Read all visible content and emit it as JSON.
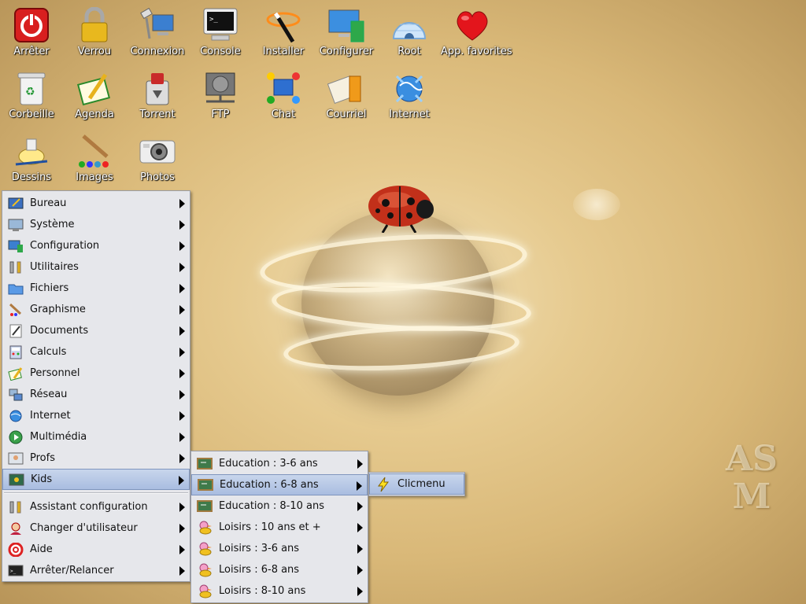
{
  "desktop_icons": [
    {
      "label": "Arrêter",
      "icon": "power-icon"
    },
    {
      "label": "Verrou",
      "icon": "lock-icon"
    },
    {
      "label": "Connexion",
      "icon": "network-connection-icon"
    },
    {
      "label": "Console",
      "icon": "terminal-icon"
    },
    {
      "label": "Installer",
      "icon": "magic-wand-icon"
    },
    {
      "label": "Configurer",
      "icon": "config-monitor-icon"
    },
    {
      "label": "Root",
      "icon": "igloo-icon"
    },
    {
      "label": "App. favorites",
      "icon": "heart-icon"
    },
    {
      "label": "Corbeille",
      "icon": "trash-icon"
    },
    {
      "label": "Agenda",
      "icon": "agenda-icon"
    },
    {
      "label": "Torrent",
      "icon": "torrent-icon"
    },
    {
      "label": "FTP",
      "icon": "ftp-icon"
    },
    {
      "label": "Chat",
      "icon": "chat-icon"
    },
    {
      "label": "Courriel",
      "icon": "mail-icon"
    },
    {
      "label": "Internet",
      "icon": "globe-icon"
    },
    {
      "label": "Dessins",
      "icon": "paint-icon"
    },
    {
      "label": "Images",
      "icon": "brush-icon"
    },
    {
      "label": "Photos",
      "icon": "camera-icon"
    }
  ],
  "main_menu": {
    "items": [
      {
        "label": "Bureau",
        "icon": "desktop-icon"
      },
      {
        "label": "Système",
        "icon": "system-icon"
      },
      {
        "label": "Configuration",
        "icon": "configuration-icon"
      },
      {
        "label": "Utilitaires",
        "icon": "tools-icon"
      },
      {
        "label": "Fichiers",
        "icon": "folder-icon"
      },
      {
        "label": "Graphisme",
        "icon": "graphics-icon"
      },
      {
        "label": "Documents",
        "icon": "documents-icon"
      },
      {
        "label": "Calculs",
        "icon": "calculator-icon"
      },
      {
        "label": "Personnel",
        "icon": "personal-icon"
      },
      {
        "label": "Réseau",
        "icon": "network-icon"
      },
      {
        "label": "Internet",
        "icon": "internet-icon"
      },
      {
        "label": "Multimédia",
        "icon": "multimedia-icon"
      },
      {
        "label": "Profs",
        "icon": "teachers-icon"
      },
      {
        "label": "Kids",
        "icon": "kids-icon"
      }
    ],
    "bottom_items": [
      {
        "label": "Assistant configuration",
        "icon": "wizard-icon"
      },
      {
        "label": "Changer d'utilisateur",
        "icon": "user-switch-icon"
      },
      {
        "label": "Aide",
        "icon": "help-icon"
      },
      {
        "label": "Arrêter/Relancer",
        "icon": "shutdown-icon"
      }
    ],
    "selected": "Kids"
  },
  "kids_menu": {
    "items": [
      {
        "label": "Education : 3-6 ans",
        "icon": "chalkboard-icon"
      },
      {
        "label": "Education : 6-8 ans",
        "icon": "chalkboard-icon"
      },
      {
        "label": "Education : 8-10 ans",
        "icon": "chalkboard-icon"
      },
      {
        "label": "Loisirs : 10 ans et +",
        "icon": "duck-icon"
      },
      {
        "label": "Loisirs : 3-6 ans",
        "icon": "duck-icon"
      },
      {
        "label": "Loisirs : 6-8 ans",
        "icon": "duck-icon"
      },
      {
        "label": "Loisirs : 8-10 ans",
        "icon": "duck-icon"
      }
    ],
    "selected": "Education : 6-8 ans"
  },
  "edu_menu": {
    "items": [
      {
        "label": "Clicmenu",
        "icon": "lightning-icon"
      }
    ]
  },
  "colors": {
    "menu_bg": "#e6e7eb",
    "menu_selected": "#b3c6e6",
    "desktop_base": "#d9b878"
  }
}
